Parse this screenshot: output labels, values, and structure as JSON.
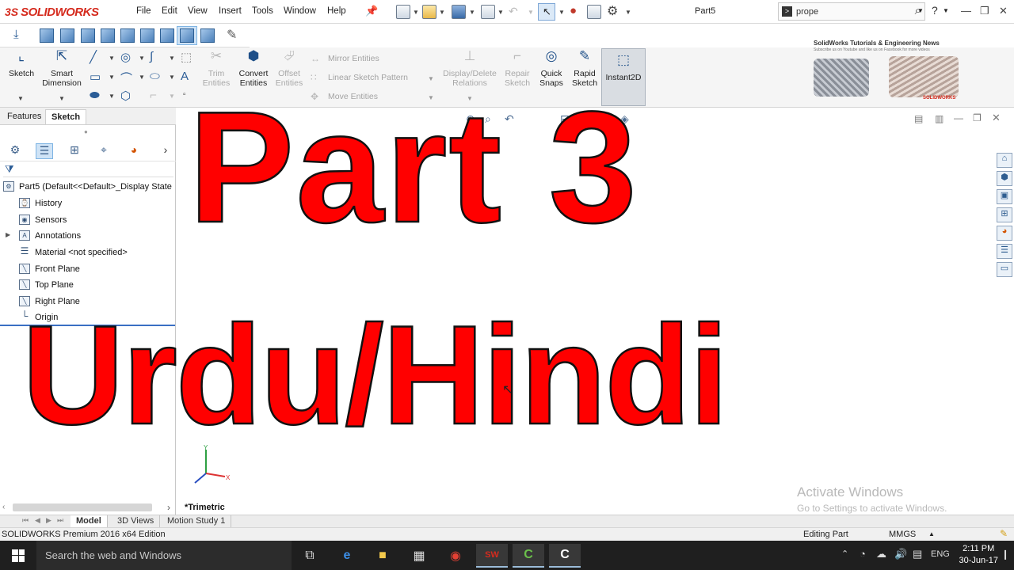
{
  "app": {
    "logo_ds": "3S",
    "logo_name": "SOLIDWORKS",
    "document_title": "Part5",
    "menus": [
      "File",
      "Edit",
      "View",
      "Insert",
      "Tools",
      "Window",
      "Help"
    ],
    "search_value": "prope",
    "help_glyph": "?"
  },
  "command_manager": {
    "sketch": "Sketch",
    "smart_dimension": "Smart Dimension",
    "trim_entities": "Trim Entities",
    "convert_entities": "Convert Entities",
    "offset_entities": "Offset Entities",
    "mirror_entities": "Mirror Entities",
    "linear_sketch_pattern": "Linear Sketch Pattern",
    "move_entities": "Move Entities",
    "display_delete_relations": "Display/Delete Relations",
    "repair_sketch": "Repair Sketch",
    "quick_snaps": "Quick Snaps",
    "rapid_sketch": "Rapid Sketch",
    "instant2d": "Instant2D"
  },
  "banner": {
    "title": "SolidWorks Tutorials & Engineering News",
    "subtitle": "Subscribe us on Youtube and like us on Facebook for more videos",
    "brand": "SOLIDWORKS"
  },
  "left_panel": {
    "tabs": [
      "Features",
      "Sketch"
    ],
    "active_tab": "Sketch",
    "root": "Part5  (Default<<Default>_Display State",
    "tree": [
      "History",
      "Sensors",
      "Annotations",
      "Material <not specified>",
      "Front Plane",
      "Top Plane",
      "Right Plane",
      "Origin"
    ]
  },
  "overlay": {
    "line1": "Part 3",
    "line2": "Urdu/Hindi"
  },
  "graphics": {
    "view_label": "*Trimetric",
    "watermark_title": "Activate Windows",
    "watermark_sub": "Go to Settings to activate Windows.",
    "axis_x": "X",
    "axis_y": "Y"
  },
  "model_tabs": [
    "Model",
    "3D Views",
    "Motion Study 1"
  ],
  "status_bar": {
    "edition": "SOLIDWORKS Premium 2016 x64 Edition",
    "mode": "Editing Part",
    "units": "MMGS"
  },
  "taskbar": {
    "search_placeholder": "Search the web and Windows",
    "language": "ENG",
    "time": "2:11 PM",
    "date": "30-Jun-17"
  },
  "colors": {
    "brand_red": "#d52b1e",
    "overlay_red": "#ff0000",
    "taskbar_bg": "#1f1f1f"
  }
}
